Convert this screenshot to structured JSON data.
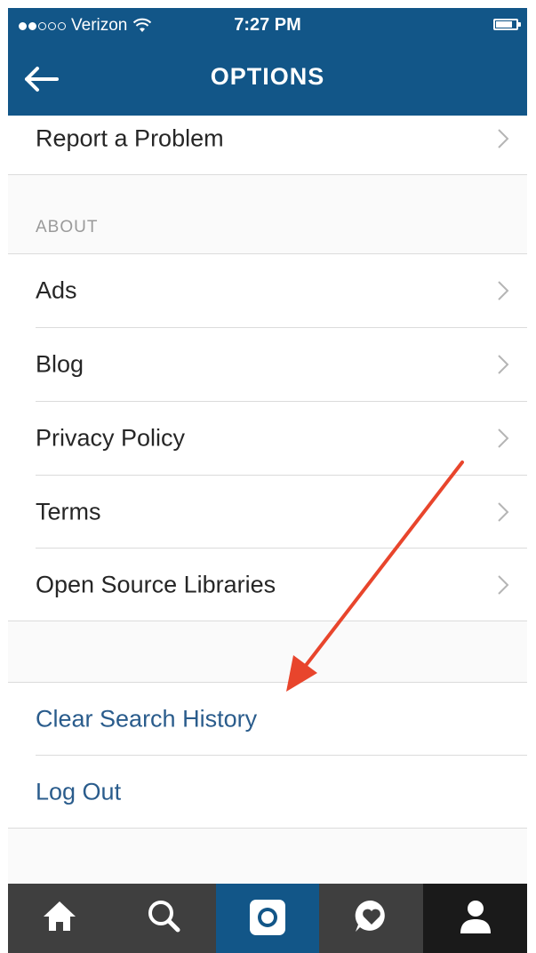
{
  "status_bar": {
    "carrier": "Verizon",
    "signal_strength": 2,
    "signal_max": 5,
    "time": "7:27 PM",
    "battery_level": 0.75
  },
  "nav": {
    "title": "OPTIONS",
    "back_icon": "arrow-left-icon"
  },
  "items": {
    "report": "Report a Problem",
    "about_header": "ABOUT",
    "ads": "Ads",
    "blog": "Blog",
    "privacy": "Privacy Policy",
    "terms": "Terms",
    "open_source": "Open Source Libraries",
    "clear_search": "Clear Search History",
    "log_out": "Log Out"
  },
  "annotation": {
    "color": "#e8452c",
    "target": "clear-search-history-row"
  },
  "tab_bar": {
    "tabs": [
      {
        "icon": "home-icon"
      },
      {
        "icon": "search-icon"
      },
      {
        "icon": "camera-icon",
        "active": true
      },
      {
        "icon": "activity-heart-icon"
      },
      {
        "icon": "profile-icon",
        "selected": true
      }
    ]
  },
  "colors": {
    "brand_blue": "#125688",
    "link_blue": "#2a5c8c",
    "tab_bar_bg": "#3f3f3f",
    "divider": "#dbdbdb",
    "section_gray": "#9a9a9a"
  }
}
